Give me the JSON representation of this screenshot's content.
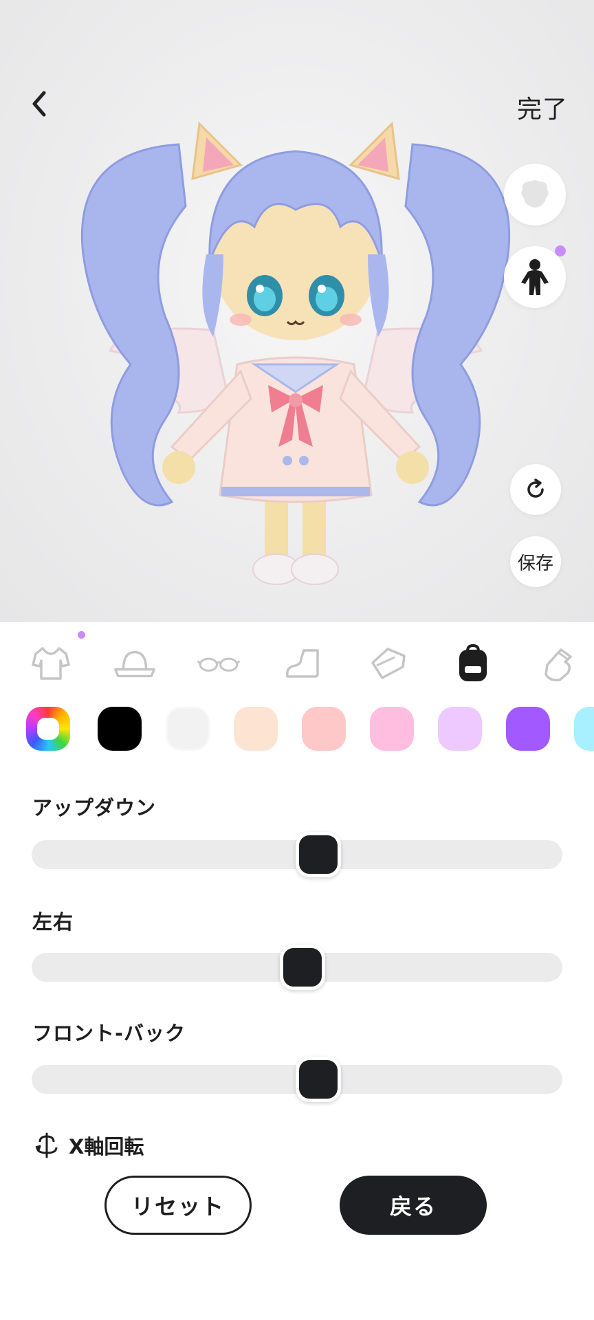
{
  "header": {
    "back_icon": "chevron-left-icon",
    "done_label": "完了"
  },
  "preview_controls": {
    "save_label": "保存"
  },
  "categories": [
    {
      "name": "outfit",
      "icon": "shirt-icon"
    },
    {
      "name": "hat",
      "icon": "hat-icon"
    },
    {
      "name": "glasses",
      "icon": "glasses-icon"
    },
    {
      "name": "shoes",
      "icon": "shoe-icon"
    },
    {
      "name": "accessory",
      "icon": "tag-icon"
    },
    {
      "name": "backpack",
      "icon": "backpack-icon",
      "selected": true
    },
    {
      "name": "glove",
      "icon": "glove-icon"
    }
  ],
  "swatches": [
    "#000000",
    "#f2f2f2",
    "#fde3d2",
    "#ffc8c8",
    "#ffbde0",
    "#eec9ff",
    "#a259ff",
    "#a8f0ff"
  ],
  "sliders": [
    {
      "label": "アップダウン",
      "value": 0.54
    },
    {
      "label": "左右",
      "value": 0.51
    },
    {
      "label": "フロント-バック",
      "value": 0.54
    }
  ],
  "rotation": {
    "label": "X軸回転"
  },
  "buttons": {
    "reset_label": "リセット",
    "back_label": "戻る"
  }
}
